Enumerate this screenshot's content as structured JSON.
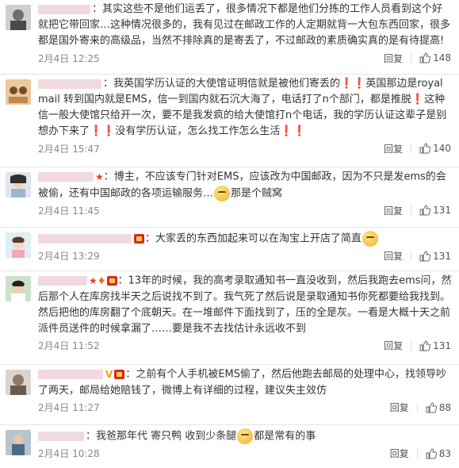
{
  "comments": [
    {
      "text": "其实这些不是他们运丢了，很多情况下都是他们分拣的工作人员看到这个好 就把它带回家…这种情况很多的，我有见过在邮政工作的人定期就背一大包东西回家，很多都是国外寄来的高级品，当然不排除真的是寄丢了，不过邮政的素质确实真的是有待提高!",
      "time": "2月4日 12:25",
      "reply_label": "回复",
      "likes": "148"
    },
    {
      "text": "我英国学历认证的大使馆证明信就是被他们寄丢的❗❗英国那边是royal mail 转到国内就是EMS，信一到国内就石沉大海了，电话打了n个部门，都是推脱❗这种信一般大使馆只给开一次，要不是我发疯的给大使馆打n个电话，我的学历认证这辈子是别想办下来了❗❗没有学历认证，怎么找工作怎么生活❗❗",
      "time": "2月4日 15:47",
      "reply_label": "回复",
      "likes": "140"
    },
    {
      "text_before": "博主，不应该专门针对EMS，应该改为中国邮政，因为不只是发ems的会被偷，还有中国邮政的各项运输服务…",
      "text_after": "那是个贼窝",
      "time": "2月4日 11:45",
      "reply_label": "回复",
      "likes": "131"
    },
    {
      "text": "大家丢的东西加起来可以在淘宝上开店了简直",
      "time": "2月4日 13:29",
      "reply_label": "回复",
      "likes": "131"
    },
    {
      "text": "13年的时候，我的高考录取通知书一直没收到，然后我跑去ems问，然后那个人在库房找半天之后说找不到了。我气死了然后说是录取通知书你死都要给我找到。然后把他的库房翻了个底朝天。在一堆邮件下面找到了，压的全是灰。一看是大概十天之前派件员送件的时候拿漏了……要是我不去找估计永远收不到",
      "time": "2月4日 11:52",
      "reply_label": "回复",
      "likes": "131"
    },
    {
      "text": "之前有个人手机被EMS偷了，然后他跑去邮局的处理中心，找领导吵了两天，邮局给她赔钱了，微博上有详细的过程，建议失主效仿",
      "time": "2月4日 11:27",
      "reply_label": "回复",
      "likes": "88"
    },
    {
      "text_before": "我爸那年代 寄只鸭 收到少条腿",
      "text_after": "都是常有的事",
      "time": "2月4日 10:28",
      "reply_label": "回复",
      "likes": "83"
    }
  ],
  "colors": {
    "accent": "#d52b1e",
    "time": "#888888",
    "text": "#333333"
  },
  "icons": {
    "like": "thumb-up-icon",
    "emoji": "smiley-emoji-icon",
    "badge": "member-badge-icon"
  }
}
